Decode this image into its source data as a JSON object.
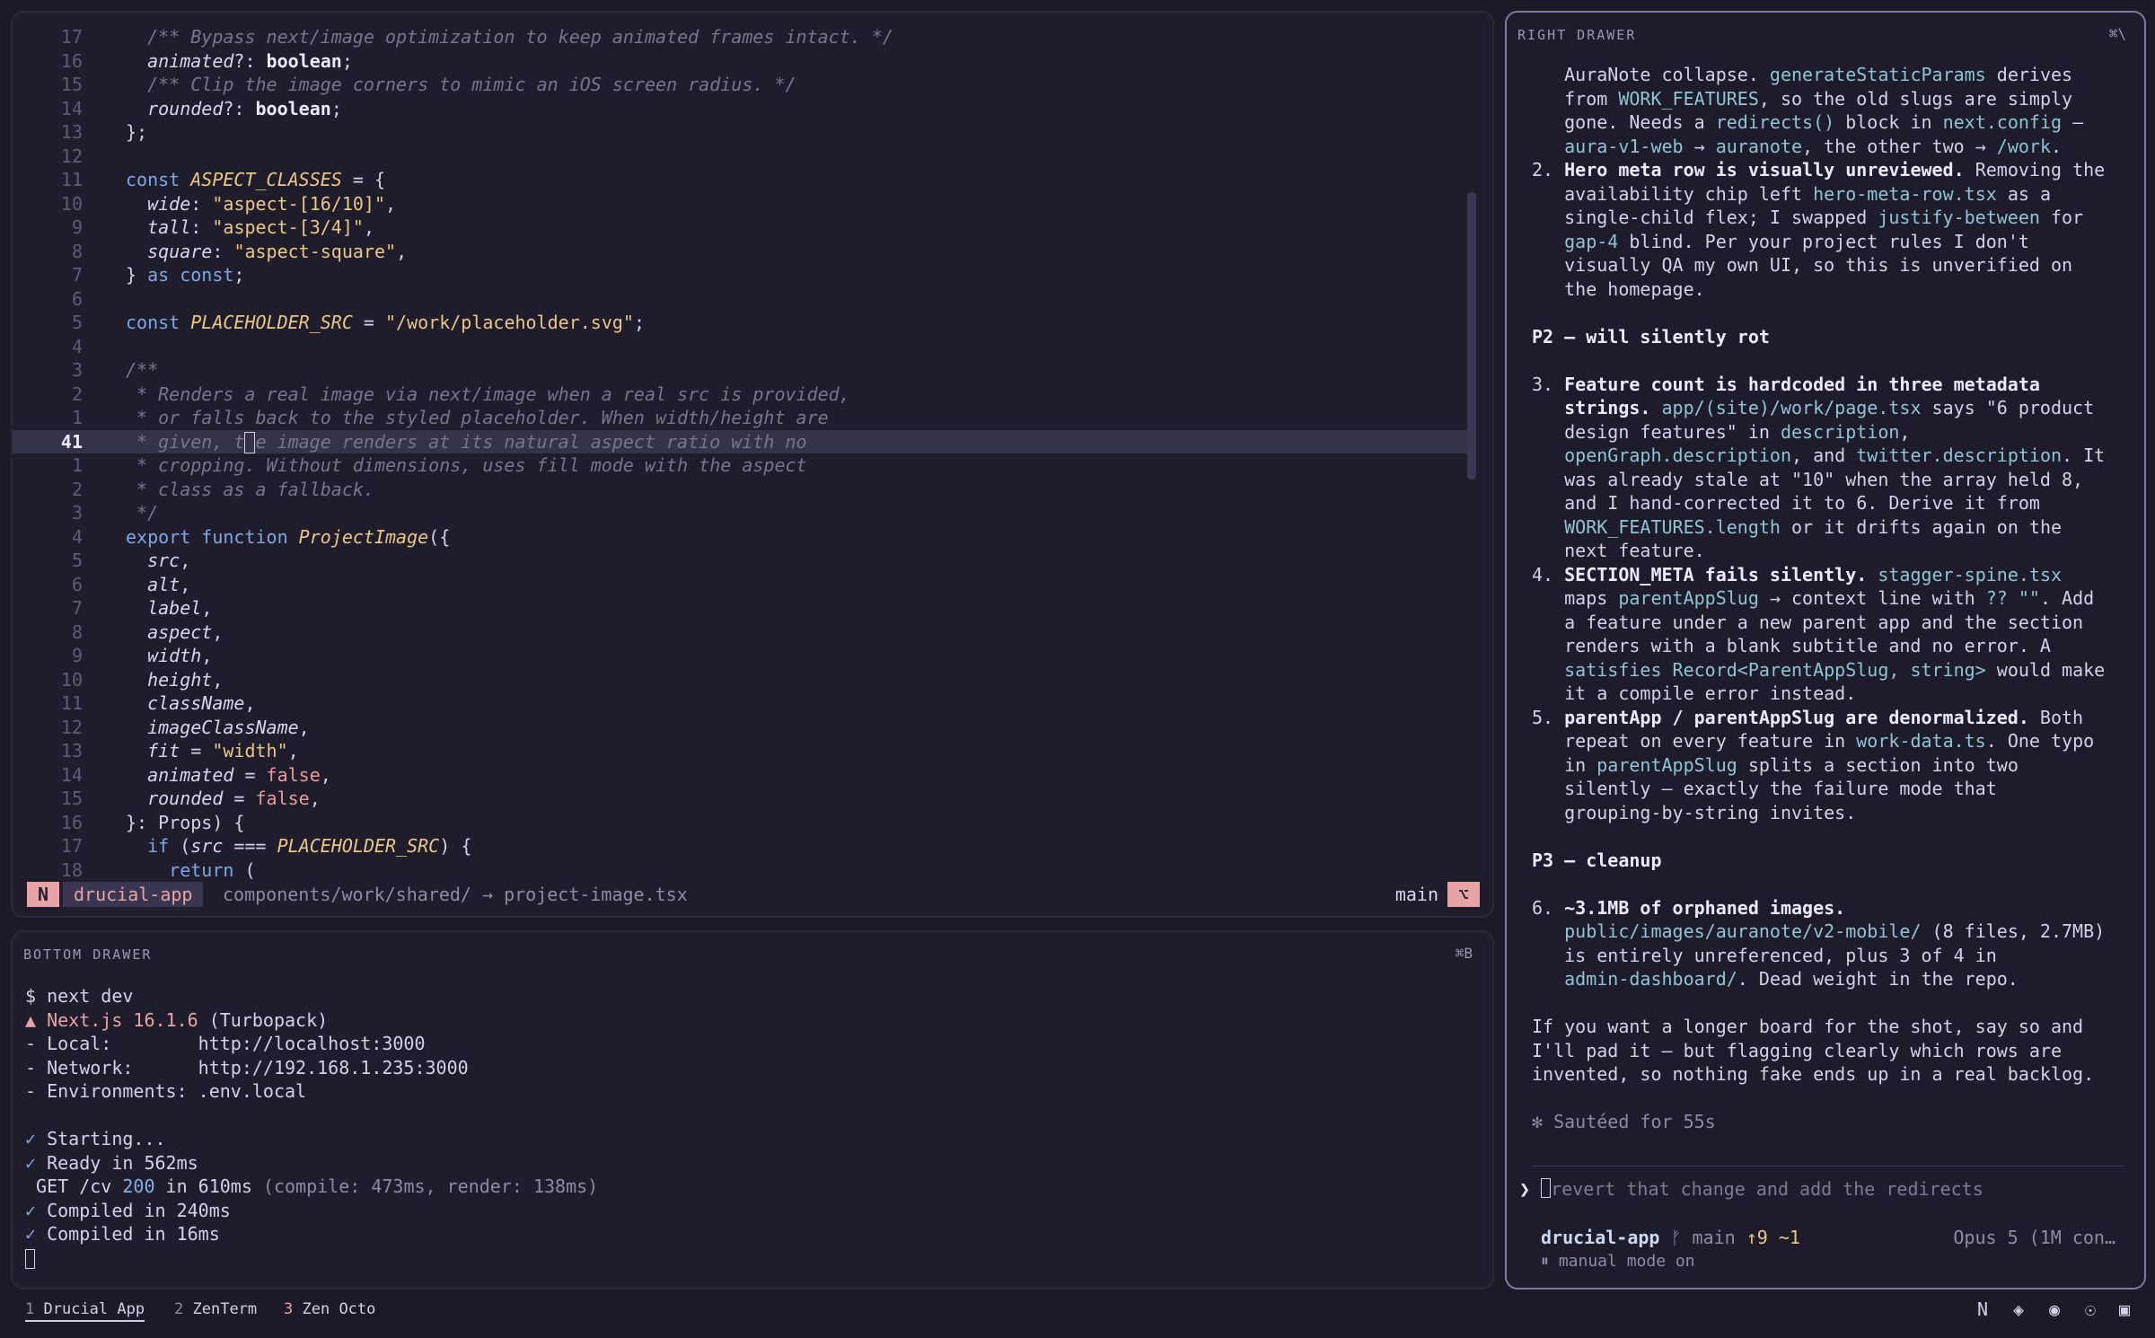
{
  "editor": {
    "lines": [
      {
        "n": "17",
        "t": "  <span class=\"cm\">/** Bypass next/image optimization to keep animated frames intact. */</span>"
      },
      {
        "n": "16",
        "t": "  <span class=\"prop\">animated</span><span class=\"plain\">?: </span><span class=\"bold\">boolean</span><span class=\"plain\">;</span>"
      },
      {
        "n": "15",
        "t": "  <span class=\"cm\">/** Clip the image corners to mimic an iOS screen radius. */</span>"
      },
      {
        "n": "14",
        "t": "  <span class=\"prop\">rounded</span><span class=\"plain\">?: </span><span class=\"bold\">boolean</span><span class=\"plain\">;</span>"
      },
      {
        "n": "13",
        "t": "<span class=\"plain\">};</span>"
      },
      {
        "n": "12",
        "t": ""
      },
      {
        "n": "11",
        "t": "<span class=\"kw\">const </span><span class=\"vr\">ASPECT_CLASSES</span><span class=\"plain\"> = {</span>"
      },
      {
        "n": "10",
        "t": "  <span class=\"prop\">wide</span><span class=\"plain\">: </span><span class=\"str\">\"aspect-[16/10]\"</span><span class=\"plain\">,</span>"
      },
      {
        "n": "9",
        "t": "  <span class=\"prop\">tall</span><span class=\"plain\">: </span><span class=\"str\">\"aspect-[3/4]\"</span><span class=\"plain\">,</span>"
      },
      {
        "n": "8",
        "t": "  <span class=\"prop\">square</span><span class=\"plain\">: </span><span class=\"str\">\"aspect-square\"</span><span class=\"plain\">,</span>"
      },
      {
        "n": "7",
        "t": "<span class=\"plain\">} </span><span class=\"kw\">as const</span><span class=\"plain\">;</span>"
      },
      {
        "n": "6",
        "t": ""
      },
      {
        "n": "5",
        "t": "<span class=\"kw\">const </span><span class=\"vr\">PLACEHOLDER_SRC</span><span class=\"plain\"> = </span><span class=\"str\">\"/work/placeholder.svg\"</span><span class=\"plain\">;</span>"
      },
      {
        "n": "4",
        "t": ""
      },
      {
        "n": "3",
        "t": "<span class=\"cm\">/**</span>"
      },
      {
        "n": "2",
        "t": "<span class=\"cm\"> * Renders a real image via next/image when a real src is provided,</span>"
      },
      {
        "n": "1",
        "t": "<span class=\"cm\"> * or falls back to the styled placeholder. When width/height are</span>"
      },
      {
        "n": "41",
        "t": "<span class=\"cm\"> * given, t</span><span class=\"cursor\"></span><span class=\"cm\">e image renders at its natural aspect ratio with no</span>",
        "cur": true
      },
      {
        "n": "1",
        "t": "<span class=\"cm\"> * cropping. Without dimensions, uses fill mode with the aspect</span>"
      },
      {
        "n": "2",
        "t": "<span class=\"cm\"> * class as a fallback.</span>"
      },
      {
        "n": "3",
        "t": "<span class=\"cm\"> */</span>"
      },
      {
        "n": "4",
        "t": "<span class=\"kw\">export function </span><span class=\"fn\">ProjectImage</span><span class=\"plain\">({</span>"
      },
      {
        "n": "5",
        "t": "  <span class=\"prop\">src</span><span class=\"plain\">,</span>"
      },
      {
        "n": "6",
        "t": "  <span class=\"prop\">alt</span><span class=\"plain\">,</span>"
      },
      {
        "n": "7",
        "t": "  <span class=\"prop\">label</span><span class=\"plain\">,</span>"
      },
      {
        "n": "8",
        "t": "  <span class=\"prop\">aspect</span><span class=\"plain\">,</span>"
      },
      {
        "n": "9",
        "t": "  <span class=\"prop\">width</span><span class=\"plain\">,</span>"
      },
      {
        "n": "10",
        "t": "  <span class=\"prop\">height</span><span class=\"plain\">,</span>"
      },
      {
        "n": "11",
        "t": "  <span class=\"prop\">className</span><span class=\"plain\">,</span>"
      },
      {
        "n": "12",
        "t": "  <span class=\"prop\">imageClassName</span><span class=\"plain\">,</span>"
      },
      {
        "n": "13",
        "t": "  <span class=\"prop\">fit</span><span class=\"plain\"> = </span><span class=\"str\">\"width\"</span><span class=\"plain\">,</span>"
      },
      {
        "n": "14",
        "t": "  <span class=\"prop\">animated</span><span class=\"plain\"> = </span><span class=\"bool\">false</span><span class=\"plain\">,</span>"
      },
      {
        "n": "15",
        "t": "  <span class=\"prop\">rounded</span><span class=\"plain\"> = </span><span class=\"bool\">false</span><span class=\"plain\">,</span>"
      },
      {
        "n": "16",
        "t": "<span class=\"plain\">}: Props) {</span>"
      },
      {
        "n": "17",
        "t": "  <span class=\"kw\">if </span><span class=\"plain\">(</span><span class=\"prop\">src</span><span class=\"plain\"> === </span><span class=\"vr\">PLACEHOLDER_SRC</span><span class=\"plain\">) {</span>"
      },
      {
        "n": "18",
        "t": "    <span class=\"kw\">return </span><span class=\"plain\">(</span>"
      }
    ],
    "status": {
      "mode": "N",
      "project": "drucial-app",
      "path": "components/work/shared/ → project-image.tsx",
      "branch": "main",
      "branch_icon": "⌥"
    }
  },
  "bottom_drawer": {
    "title": "BOTTOM DRAWER",
    "shortcut": "⌘B",
    "lines": [
      "<span>$ next dev</span>",
      "<span class=\"tri\">▲ Next.js 16.1.6</span><span> (Turbopack)</span>",
      "<span>- Local:        http://localhost:3000</span>",
      "<span>- Network:      http://192.168.1.235:3000</span>",
      "<span>- Environments: .env.local</span>",
      "",
      "<span class=\"ok\">✓</span><span> Starting...</span>",
      "<span class=\"ok\">✓</span><span> Ready in 562ms</span>",
      "<span> GET /cv </span><span class=\"num200\">200</span><span> in 610ms </span><span class=\"dim\">(compile: 473ms, render: 138ms)</span>",
      "<span class=\"ok\">✓</span><span> Compiled in 240ms</span>",
      "<span class=\"ok\">✓</span><span> Compiled in 16ms</span>",
      "<span class=\"cursor\" style=\"height:22px;width:11px\"></span>"
    ]
  },
  "right_drawer": {
    "title": "RIGHT DRAWER",
    "shortcut": "⌘\\",
    "lines": [
      "   AuraNote collapse. <span class=\"cd\">generateStaticParams</span> derives",
      "   from <span class=\"cd\">WORK_FEATURES</span>, so the old slugs are simply",
      "   gone. Needs a <span class=\"cd\">redirects()</span> block in <span class=\"cd\">next.config</span> —",
      "   <span class=\"cd\">aura-v1-web</span> → <span class=\"cd\">auranote</span>, the other two → <span class=\"cd\">/work</span>.",
      "2. <span class=\"h\">Hero meta row is visually unreviewed.</span> Removing the",
      "   availability chip left <span class=\"cd\">hero-meta-row.tsx</span> as a",
      "   single-child flex; I swapped <span class=\"cd\">justify-between</span> for",
      "   <span class=\"cd\">gap-4</span> blind. Per your project rules I don't",
      "   visually QA my own UI, so this is unverified on",
      "   the homepage.",
      "",
      "<span class=\"h\">P2 — will silently rot</span>",
      "",
      "3. <span class=\"h\">Feature count is hardcoded in three metadata</span>",
      "   <span class=\"h\">strings.</span> <span class=\"cd\">app/(site)/work/page.tsx</span> says \"6 product",
      "   design features\" in <span class=\"cd\">description</span>,",
      "   <span class=\"cd\">openGraph.description</span>, and <span class=\"cd\">twitter.description</span>. It",
      "   was already stale at \"10\" when the array held 8,",
      "   and I hand-corrected it to 6. Derive it from",
      "   <span class=\"cd\">WORK_FEATURES.length</span> or it drifts again on the",
      "   next feature.",
      "4. <span class=\"h\">SECTION_META fails silently.</span> <span class=\"cd\">stagger-spine.tsx</span>",
      "   maps <span class=\"cd\">parentAppSlug</span> → context line with <span class=\"cd\">?? \"\"</span>. Add",
      "   a feature under a new parent app and the section",
      "   renders with a blank subtitle and no error. A",
      "   <span class=\"cd\">satisfies Record&lt;ParentAppSlug, string&gt;</span> would make",
      "   it a compile error instead.",
      "5. <span class=\"h\">parentApp / parentAppSlug are denormalized.</span> Both",
      "   repeat on every feature in <span class=\"cd\">work-data.ts</span>. One typo",
      "   in <span class=\"cd\">parentAppSlug</span> splits a section into two",
      "   silently — exactly the failure mode that",
      "   grouping-by-string invites.",
      "",
      "<span class=\"h\">P3 — cleanup</span>",
      "",
      "6. <span class=\"h\">~3.1MB of orphaned images.</span>",
      "   <span class=\"cd\">public/images/auranote/v2-mobile/</span> (8 files, 2.7MB)",
      "   is entirely unreferenced, plus 3 of 4 in",
      "   <span class=\"cd\">admin-dashboard/</span>. Dead weight in the repo.",
      "",
      "If you want a longer board for the shot, say so and",
      "I'll pad it — but flagging clearly which rows are",
      "invented, so nothing fake ends up in a real backlog.",
      "",
      "<span class=\"dim\">✻ Sautéed for 55s</span>"
    ],
    "prompt_arrow": "❯",
    "prompt_text": "revert that change and add the redirects",
    "footer_app": "drucial-app",
    "footer_branch": " ᚠ main ",
    "footer_changes": "↑9 ~1",
    "footer_model": "Opus 5 (1M con…",
    "footer_mode": "⏸ manual mode on"
  },
  "tabs": [
    {
      "num": "1",
      "label": "Drucial App",
      "active": true
    },
    {
      "num": "2",
      "label": "ZenTerm",
      "active": false
    },
    {
      "num": "3",
      "label": "Zen Octo",
      "active": false
    }
  ],
  "tray_icons": [
    "N",
    "◈",
    "◉",
    "☉",
    "▣"
  ]
}
